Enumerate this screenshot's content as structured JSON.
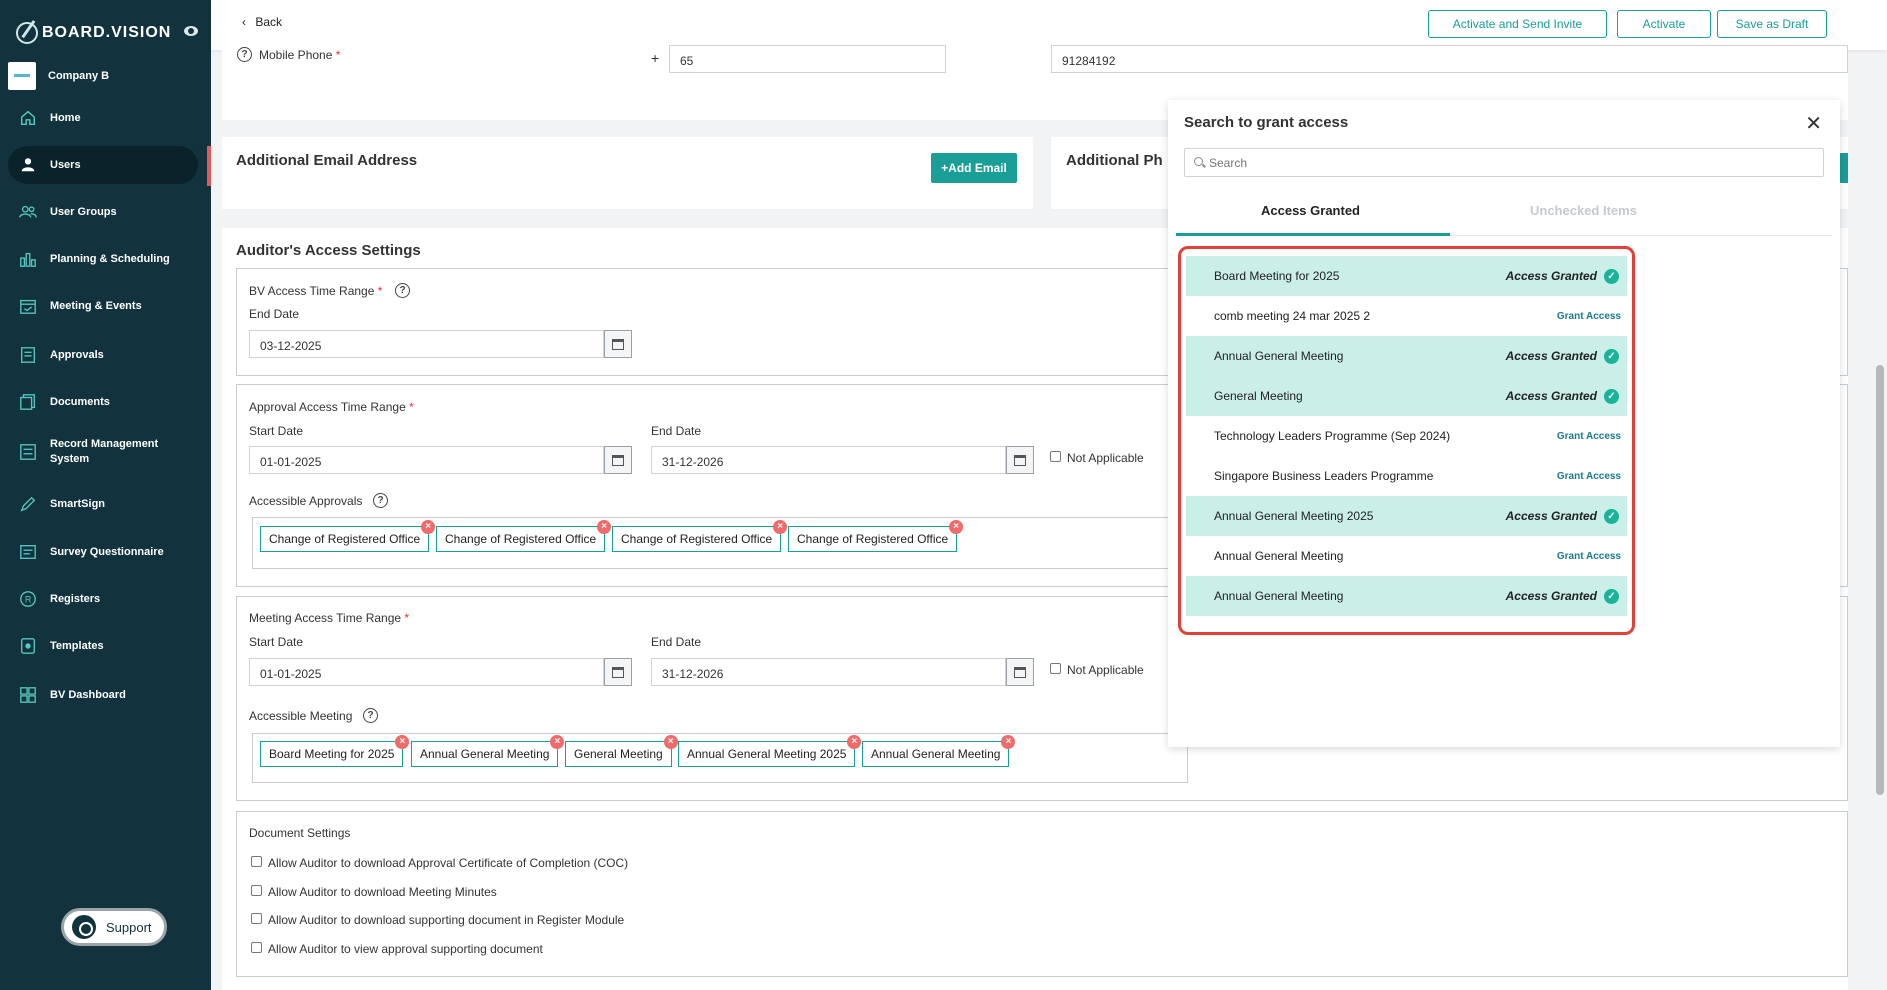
{
  "sidebar": {
    "logo": "BOARD.VISION",
    "company": "Company B",
    "items": [
      {
        "label": "Home",
        "icon": "home-icon"
      },
      {
        "label": "Users",
        "icon": "user-icon"
      },
      {
        "label": "User Groups",
        "icon": "users-icon"
      },
      {
        "label": "Planning & Scheduling",
        "icon": "chart-icon"
      },
      {
        "label": "Meeting & Events",
        "icon": "calendar-icon"
      },
      {
        "label": "Approvals",
        "icon": "list-icon"
      },
      {
        "label": "Documents",
        "icon": "document-icon"
      },
      {
        "label": "Record Management System",
        "icon": "record-icon"
      },
      {
        "label": "SmartSign",
        "icon": "pen-icon"
      },
      {
        "label": "Survey Questionnaire",
        "icon": "survey-icon"
      },
      {
        "label": "Registers",
        "icon": "registered-icon"
      },
      {
        "label": "Templates",
        "icon": "template-icon"
      },
      {
        "label": "BV Dashboard",
        "icon": "dashboard-icon"
      }
    ],
    "support": "Support"
  },
  "topbar": {
    "back": "Back",
    "activate_send": "Activate and Send Invite",
    "activate": "Activate",
    "save_draft": "Save as Draft"
  },
  "phone": {
    "label": "Mobile Phone",
    "plus": "+",
    "code": "65",
    "number": "91284192"
  },
  "email": {
    "title": "Additional Email Address",
    "add": "+Add Email",
    "phone_title": "Additional Ph"
  },
  "access": {
    "title": "Auditor's Access Settings",
    "bv_range": "BV Access Time Range",
    "end_date_label": "End Date",
    "bv_end": "03-12-2025",
    "approval_range": "Approval Access Time Range",
    "start_date_label": "Start Date",
    "approval_start": "01-01-2025",
    "approval_end": "31-12-2026",
    "not_applicable": "Not Applicable",
    "accessible_approvals": "Accessible Approvals",
    "approval_tags": [
      "Change of Registered Office",
      "Change of Registered Office",
      "Change of Registered Office",
      "Change of Registered Office"
    ],
    "meeting_range": "Meeting Access Time Range",
    "meeting_start": "01-01-2025",
    "meeting_end": "31-12-2026",
    "accessible_meeting": "Accessible Meeting",
    "meeting_tags": [
      "Board Meeting for 2025",
      "Annual General Meeting",
      "General Meeting",
      "Annual General Meeting 2025",
      "Annual General Meeting"
    ]
  },
  "docs": {
    "title": "Document Settings",
    "options": [
      "Allow Auditor to download Approval Certificate of Completion (COC)",
      "Allow Auditor to download Meeting Minutes",
      "Allow Auditor to download supporting document in Register Module",
      "Allow Auditor to view approval supporting document"
    ]
  },
  "popup": {
    "title": "Search to grant access",
    "close": "✕",
    "search_placeholder": "Search",
    "tab_granted": "Access Granted",
    "tab_unchecked": "Unchecked Items",
    "rows": [
      {
        "name": "Board Meeting for 2025",
        "status": "Access Granted"
      },
      {
        "name": "comb meeting 24 mar 2025 2",
        "status": "Grant Access"
      },
      {
        "name": "Annual General Meeting",
        "status": "Access Granted"
      },
      {
        "name": "General Meeting",
        "status": "Access Granted"
      },
      {
        "name": "Technology Leaders Programme (Sep 2024)",
        "status": "Grant Access"
      },
      {
        "name": "Singapore Business Leaders Programme",
        "status": "Grant Access"
      },
      {
        "name": "Annual General Meeting 2025",
        "status": "Access Granted"
      },
      {
        "name": "Annual General Meeting",
        "status": "Grant Access"
      },
      {
        "name": "Annual General Meeting",
        "status": "Access Granted"
      }
    ]
  },
  "colors": {
    "sidebar": "#12333d",
    "accent": "#1a9e97",
    "granted_row": "#c9efe8",
    "highlight": "#e0423a"
  }
}
